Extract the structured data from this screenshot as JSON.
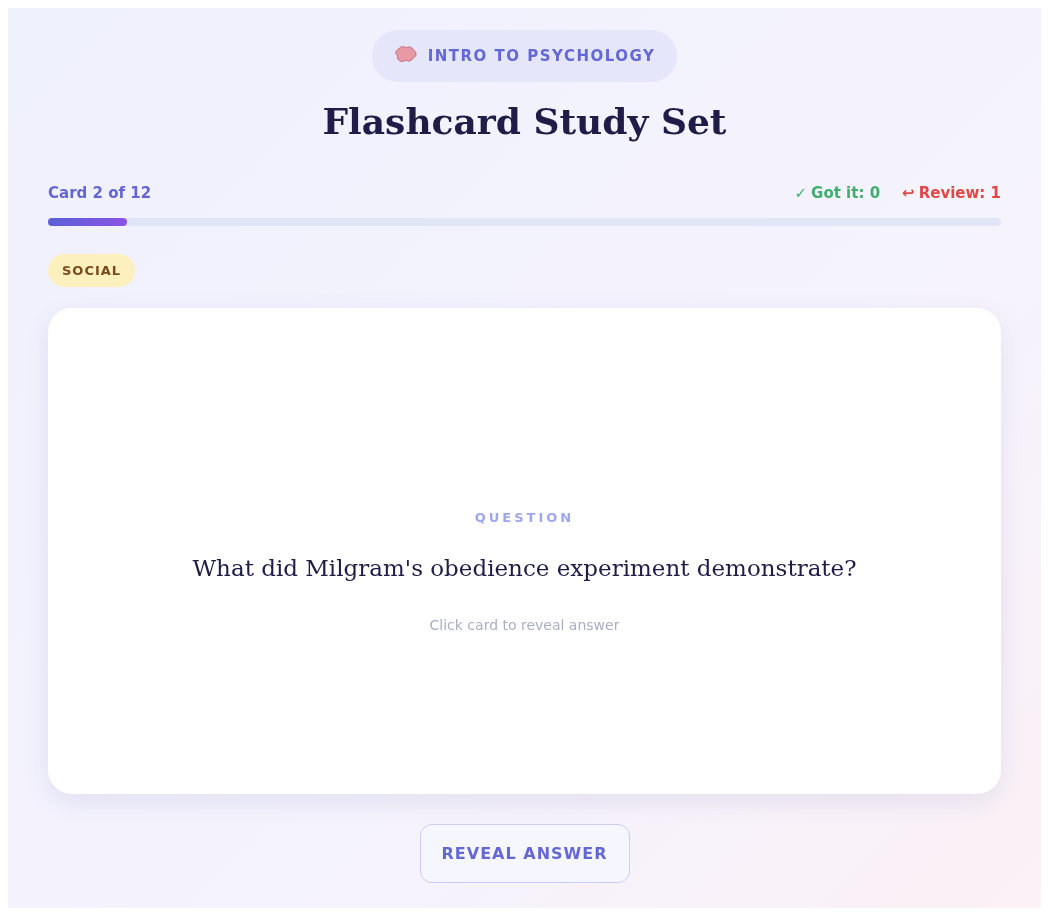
{
  "course_pill": {
    "label": "INTRO TO PSYCHOLOGY"
  },
  "title": "Flashcard Study Set",
  "progress": {
    "label": "Card 2 of 12",
    "level": 0.083
  },
  "stats": [
    {
      "icon": "✓",
      "label": "Got it: 0",
      "color": "#3fae6e"
    },
    {
      "icon": "↩",
      "label": "Review: 1",
      "color": "#e04848"
    }
  ],
  "category_tag": "SOCIAL",
  "card": {
    "side_label": "QUESTION",
    "text": "What did Milgram's obedience experiment demonstrate?",
    "hint": "Click card to reveal answer"
  },
  "reveal_button": "REVEAL ANSWER"
}
